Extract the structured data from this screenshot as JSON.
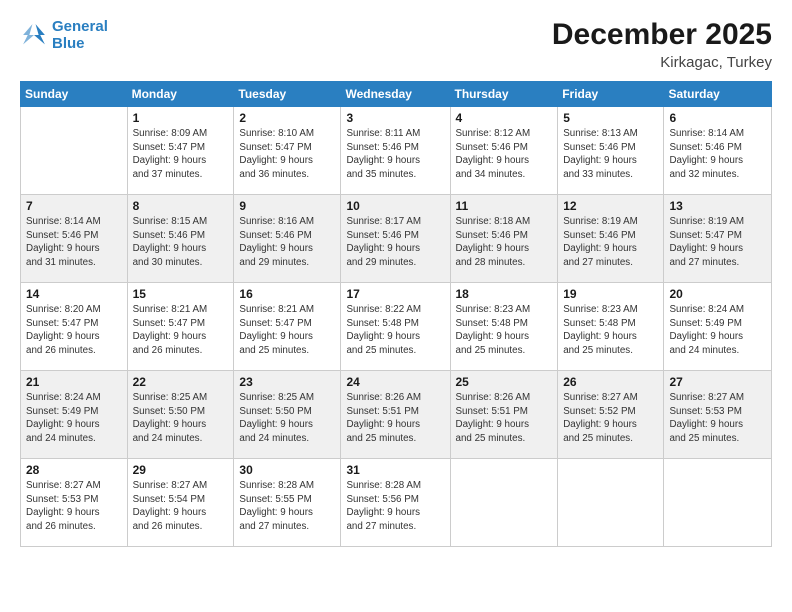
{
  "logo": {
    "line1": "General",
    "line2": "Blue"
  },
  "title": "December 2025",
  "location": "Kirkagac, Turkey",
  "days_of_week": [
    "Sunday",
    "Monday",
    "Tuesday",
    "Wednesday",
    "Thursday",
    "Friday",
    "Saturday"
  ],
  "weeks": [
    [
      {
        "day": "",
        "info": ""
      },
      {
        "day": "1",
        "info": "Sunrise: 8:09 AM\nSunset: 5:47 PM\nDaylight: 9 hours\nand 37 minutes."
      },
      {
        "day": "2",
        "info": "Sunrise: 8:10 AM\nSunset: 5:47 PM\nDaylight: 9 hours\nand 36 minutes."
      },
      {
        "day": "3",
        "info": "Sunrise: 8:11 AM\nSunset: 5:46 PM\nDaylight: 9 hours\nand 35 minutes."
      },
      {
        "day": "4",
        "info": "Sunrise: 8:12 AM\nSunset: 5:46 PM\nDaylight: 9 hours\nand 34 minutes."
      },
      {
        "day": "5",
        "info": "Sunrise: 8:13 AM\nSunset: 5:46 PM\nDaylight: 9 hours\nand 33 minutes."
      },
      {
        "day": "6",
        "info": "Sunrise: 8:14 AM\nSunset: 5:46 PM\nDaylight: 9 hours\nand 32 minutes."
      }
    ],
    [
      {
        "day": "7",
        "info": "Sunrise: 8:14 AM\nSunset: 5:46 PM\nDaylight: 9 hours\nand 31 minutes."
      },
      {
        "day": "8",
        "info": "Sunrise: 8:15 AM\nSunset: 5:46 PM\nDaylight: 9 hours\nand 30 minutes."
      },
      {
        "day": "9",
        "info": "Sunrise: 8:16 AM\nSunset: 5:46 PM\nDaylight: 9 hours\nand 29 minutes."
      },
      {
        "day": "10",
        "info": "Sunrise: 8:17 AM\nSunset: 5:46 PM\nDaylight: 9 hours\nand 29 minutes."
      },
      {
        "day": "11",
        "info": "Sunrise: 8:18 AM\nSunset: 5:46 PM\nDaylight: 9 hours\nand 28 minutes."
      },
      {
        "day": "12",
        "info": "Sunrise: 8:19 AM\nSunset: 5:46 PM\nDaylight: 9 hours\nand 27 minutes."
      },
      {
        "day": "13",
        "info": "Sunrise: 8:19 AM\nSunset: 5:47 PM\nDaylight: 9 hours\nand 27 minutes."
      }
    ],
    [
      {
        "day": "14",
        "info": "Sunrise: 8:20 AM\nSunset: 5:47 PM\nDaylight: 9 hours\nand 26 minutes."
      },
      {
        "day": "15",
        "info": "Sunrise: 8:21 AM\nSunset: 5:47 PM\nDaylight: 9 hours\nand 26 minutes."
      },
      {
        "day": "16",
        "info": "Sunrise: 8:21 AM\nSunset: 5:47 PM\nDaylight: 9 hours\nand 25 minutes."
      },
      {
        "day": "17",
        "info": "Sunrise: 8:22 AM\nSunset: 5:48 PM\nDaylight: 9 hours\nand 25 minutes."
      },
      {
        "day": "18",
        "info": "Sunrise: 8:23 AM\nSunset: 5:48 PM\nDaylight: 9 hours\nand 25 minutes."
      },
      {
        "day": "19",
        "info": "Sunrise: 8:23 AM\nSunset: 5:48 PM\nDaylight: 9 hours\nand 25 minutes."
      },
      {
        "day": "20",
        "info": "Sunrise: 8:24 AM\nSunset: 5:49 PM\nDaylight: 9 hours\nand 24 minutes."
      }
    ],
    [
      {
        "day": "21",
        "info": "Sunrise: 8:24 AM\nSunset: 5:49 PM\nDaylight: 9 hours\nand 24 minutes."
      },
      {
        "day": "22",
        "info": "Sunrise: 8:25 AM\nSunset: 5:50 PM\nDaylight: 9 hours\nand 24 minutes."
      },
      {
        "day": "23",
        "info": "Sunrise: 8:25 AM\nSunset: 5:50 PM\nDaylight: 9 hours\nand 24 minutes."
      },
      {
        "day": "24",
        "info": "Sunrise: 8:26 AM\nSunset: 5:51 PM\nDaylight: 9 hours\nand 25 minutes."
      },
      {
        "day": "25",
        "info": "Sunrise: 8:26 AM\nSunset: 5:51 PM\nDaylight: 9 hours\nand 25 minutes."
      },
      {
        "day": "26",
        "info": "Sunrise: 8:27 AM\nSunset: 5:52 PM\nDaylight: 9 hours\nand 25 minutes."
      },
      {
        "day": "27",
        "info": "Sunrise: 8:27 AM\nSunset: 5:53 PM\nDaylight: 9 hours\nand 25 minutes."
      }
    ],
    [
      {
        "day": "28",
        "info": "Sunrise: 8:27 AM\nSunset: 5:53 PM\nDaylight: 9 hours\nand 26 minutes."
      },
      {
        "day": "29",
        "info": "Sunrise: 8:27 AM\nSunset: 5:54 PM\nDaylight: 9 hours\nand 26 minutes."
      },
      {
        "day": "30",
        "info": "Sunrise: 8:28 AM\nSunset: 5:55 PM\nDaylight: 9 hours\nand 27 minutes."
      },
      {
        "day": "31",
        "info": "Sunrise: 8:28 AM\nSunset: 5:56 PM\nDaylight: 9 hours\nand 27 minutes."
      },
      {
        "day": "",
        "info": ""
      },
      {
        "day": "",
        "info": ""
      },
      {
        "day": "",
        "info": ""
      }
    ]
  ]
}
